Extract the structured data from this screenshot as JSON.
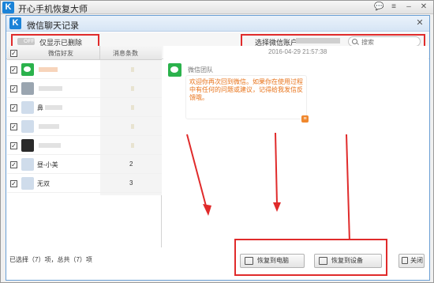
{
  "app": {
    "title": "开心手机恢复大师",
    "logo_letter": "K"
  },
  "dialog": {
    "title": "微信聊天记录",
    "logo_letter": "K"
  },
  "filter": {
    "toggle_state": "OFF",
    "toggle_label": "仅显示已删除",
    "account_label": "选择微信账户",
    "search_placeholder": "搜索"
  },
  "list": {
    "col_friend": "微信好友",
    "col_count": "消息条数",
    "rows": [
      {
        "name": "",
        "count": "",
        "avatar": "wechat"
      },
      {
        "name": "",
        "count": "",
        "avatar": "grey"
      },
      {
        "name": "鼻",
        "count": "",
        "avatar": "light"
      },
      {
        "name": "",
        "count": "",
        "avatar": "light"
      },
      {
        "name": "",
        "count": "",
        "avatar": "dark"
      },
      {
        "name": "昼-小美",
        "count": "2",
        "avatar": "light"
      },
      {
        "name": "无双",
        "count": "3",
        "avatar": "light"
      }
    ]
  },
  "summary": "已选择（7）项，总共（7）项",
  "conversation": {
    "timestamp": "2016-04-29 21:57:38",
    "sender": "微信团队",
    "message": "欢迎你再次回到微信。如果你在使用过程中有任何的问题或建议，记得给我发信反馈哦。"
  },
  "buttons": {
    "restore_pc": "恢复到电脑",
    "restore_device": "恢复到设备",
    "close": "关闭"
  },
  "colors": {
    "accent": "#1b83d8",
    "highlight": "#e02b2b",
    "message_text": "#e8731a",
    "wechat_green": "#2bb24c"
  }
}
